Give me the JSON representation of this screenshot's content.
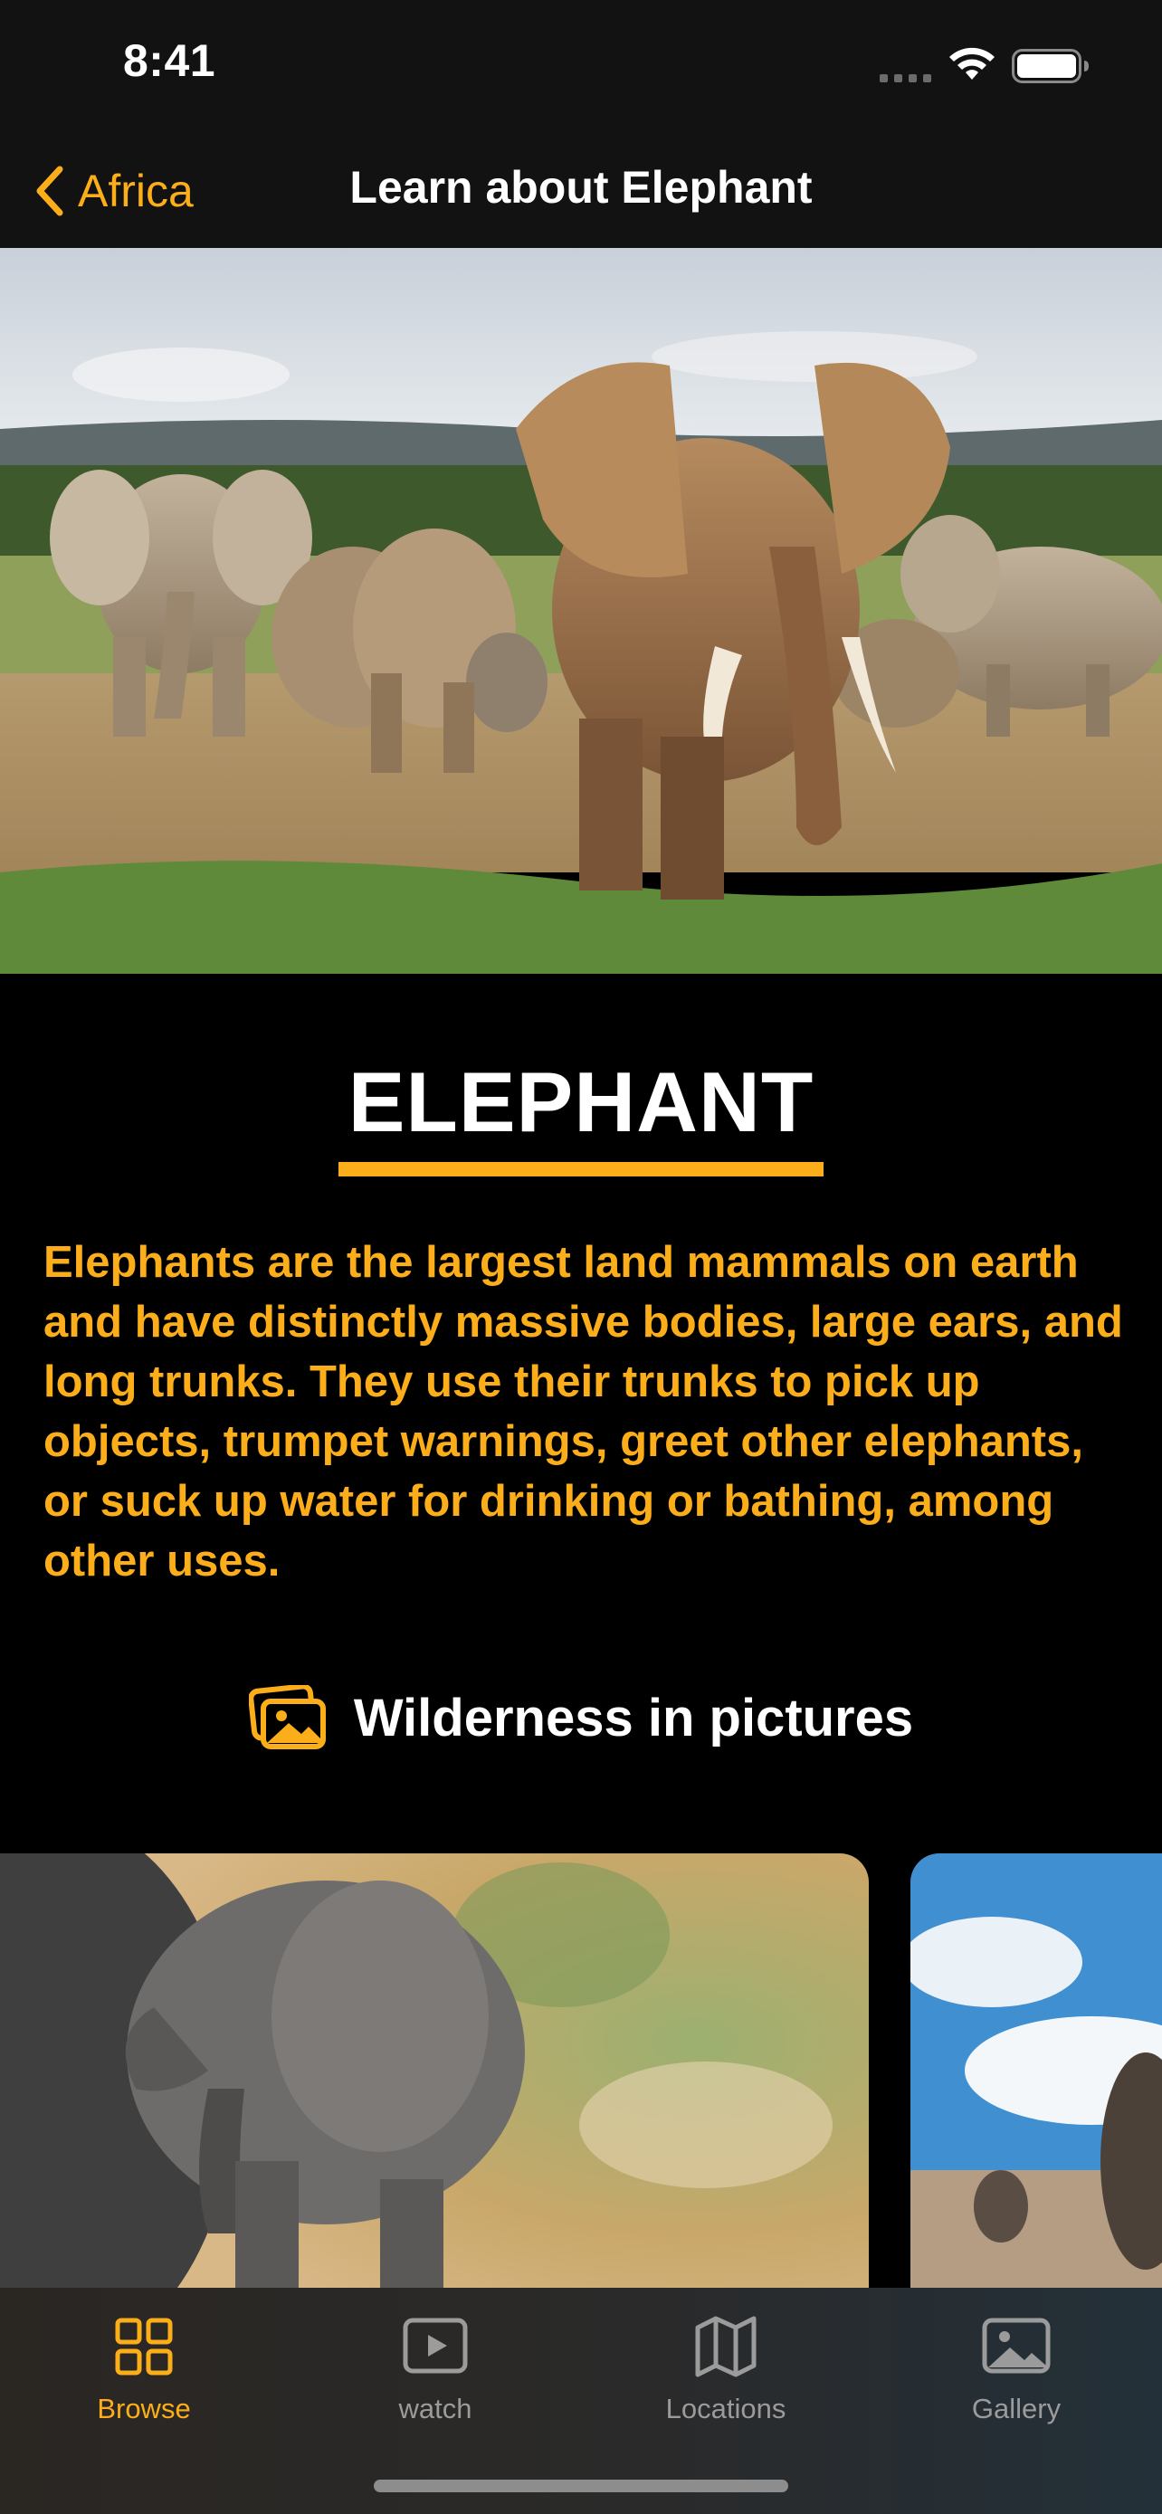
{
  "status_bar": {
    "time": "8:41",
    "icons": [
      "signal-icon",
      "wifi-icon",
      "battery-icon"
    ]
  },
  "nav": {
    "back_label": "Africa",
    "title": "Learn about Elephant",
    "back_icon": "chevron-left-icon"
  },
  "hero": {
    "image": "elephant-herd-photo"
  },
  "animal": {
    "name": "ELEPHANT",
    "description": "Elephants are the largest land mammals on earth and have distinctly massive bodies, large ears, and long trunks. They use their trunks to pick up objects, trumpet warnings, greet other elephants, or suck up water for drinking or bathing, among other uses."
  },
  "gallery": {
    "heading": "Wilderness in pictures",
    "heading_icon": "photos-icon",
    "cards": [
      {
        "image": "baby-elephant-photo"
      },
      {
        "image": "elephants-under-blue-sky-photo"
      }
    ]
  },
  "tab_bar": {
    "tabs": [
      {
        "label": "Browse",
        "icon": "grid-icon",
        "active": true
      },
      {
        "label": "watch",
        "icon": "play-icon",
        "active": false
      },
      {
        "label": "Locations",
        "icon": "map-icon",
        "active": false
      },
      {
        "label": "Gallery",
        "icon": "photo-icon",
        "active": false
      }
    ]
  },
  "colors": {
    "accent": "#FBAE19",
    "background": "#000000",
    "bar_background": "#121212",
    "inactive_tab": "#9B9B9B"
  }
}
